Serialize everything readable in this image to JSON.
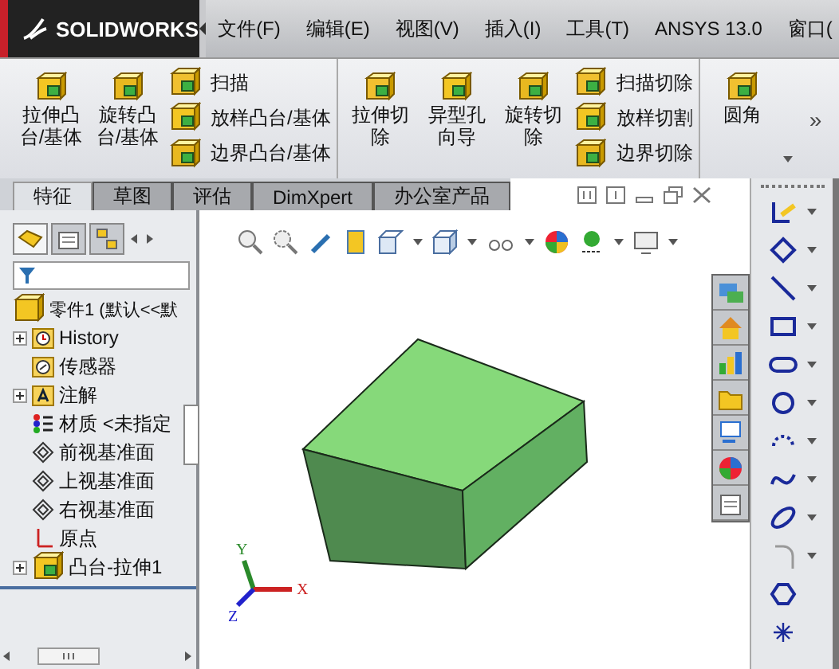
{
  "app": {
    "logo": "SOLIDWORKS"
  },
  "menu": [
    {
      "label": "文件(F)"
    },
    {
      "label": "编辑(E)"
    },
    {
      "label": "视图(V)"
    },
    {
      "label": "插入(I)"
    },
    {
      "label": "工具(T)"
    },
    {
      "label": "ANSYS 13.0"
    },
    {
      "label": "窗口("
    }
  ],
  "ribbon": {
    "groups": [
      {
        "large": [
          {
            "label": "拉伸凸台/基体"
          },
          {
            "label": "旋转凸台/基体"
          }
        ],
        "small": [
          {
            "label": "扫描"
          },
          {
            "label": "放样凸台/基体"
          },
          {
            "label": "边界凸台/基体"
          }
        ]
      },
      {
        "large": [
          {
            "label": "拉伸切除"
          },
          {
            "label": "异型孔向导"
          },
          {
            "label": "旋转切除"
          }
        ],
        "small": [
          {
            "label": "扫描切除"
          },
          {
            "label": "放样切割"
          },
          {
            "label": "边界切除"
          }
        ]
      },
      {
        "large": [
          {
            "label": "圆角"
          }
        ]
      }
    ],
    "more": "»"
  },
  "tabs": [
    {
      "label": "特征",
      "selected": true
    },
    {
      "label": "草图",
      "selected": false
    },
    {
      "label": "评估",
      "selected": false
    },
    {
      "label": "DimXpert",
      "selected": false
    },
    {
      "label": "办公室产品",
      "selected": false
    }
  ],
  "panel_tabs": [
    {
      "selected": true
    },
    {
      "selected": false
    },
    {
      "selected": false
    }
  ],
  "tree": {
    "root": "零件1 (默认<<默",
    "items": [
      {
        "label": "History",
        "kind": "history",
        "expandable": true
      },
      {
        "label": "传感器",
        "kind": "sensor",
        "expandable": false
      },
      {
        "label": "注解",
        "kind": "annotation",
        "expandable": true
      },
      {
        "label": "材质 <未指定",
        "kind": "material",
        "expandable": false
      },
      {
        "label": "前视基准面",
        "kind": "plane",
        "expandable": false
      },
      {
        "label": "上视基准面",
        "kind": "plane",
        "expandable": false
      },
      {
        "label": "右视基准面",
        "kind": "plane",
        "expandable": false
      },
      {
        "label": "原点",
        "kind": "origin",
        "expandable": false
      },
      {
        "label": "凸台-拉伸1",
        "kind": "feature",
        "expandable": true
      }
    ]
  },
  "triad": {
    "x": "X",
    "y": "Y",
    "z": "Z"
  }
}
